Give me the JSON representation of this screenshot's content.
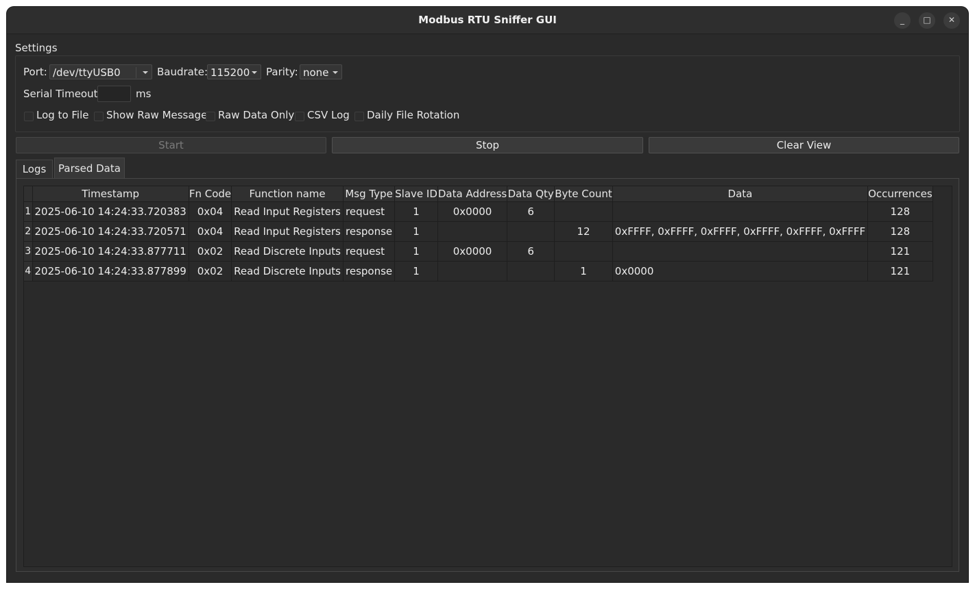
{
  "window": {
    "title": "Modbus RTU Sniffer GUI",
    "controls": {
      "minimize": "_",
      "maximize": "□",
      "close": "✕"
    }
  },
  "settings": {
    "group_label": "Settings",
    "port_label": "Port:",
    "port_value": "/dev/ttyUSB0",
    "baudrate_label": "Baudrate:",
    "baudrate_value": "115200",
    "parity_label": "Parity:",
    "parity_value": "none",
    "timeout_label": "Serial Timeout:",
    "timeout_value": "",
    "timeout_unit": "ms",
    "checkboxes": [
      {
        "label": "Log to File",
        "checked": false
      },
      {
        "label": "Show Raw Message",
        "checked": false
      },
      {
        "label": "Raw Data Only",
        "checked": false
      },
      {
        "label": "CSV Log",
        "checked": false
      },
      {
        "label": "Daily File Rotation",
        "checked": false
      }
    ]
  },
  "actions": {
    "start": "Start",
    "stop": "Stop",
    "clear": "Clear View"
  },
  "tabs": [
    {
      "label": "Logs"
    },
    {
      "label": "Parsed Data"
    }
  ],
  "table": {
    "columns": [
      "Timestamp",
      "Fn Code",
      "Function name",
      "Msg Type",
      "Slave ID",
      "Data Address",
      "Data Qty",
      "Byte Count",
      "Data",
      "Occurrences"
    ],
    "rows": [
      {
        "n": "1",
        "cells": [
          "2025-06-10 14:24:33.720383",
          "0x04",
          "Read Input Registers",
          "request",
          "1",
          "0x0000",
          "6",
          "",
          "",
          "128"
        ]
      },
      {
        "n": "2",
        "cells": [
          "2025-06-10 14:24:33.720571",
          "0x04",
          "Read Input Registers",
          "response",
          "1",
          "",
          "",
          "12",
          "0xFFFF, 0xFFFF, 0xFFFF, 0xFFFF, 0xFFFF, 0xFFFF",
          "128"
        ]
      },
      {
        "n": "3",
        "cells": [
          "2025-06-10 14:24:33.877711",
          "0x02",
          "Read Discrete Inputs",
          "request",
          "1",
          "0x0000",
          "6",
          "",
          "",
          "121"
        ]
      },
      {
        "n": "4",
        "cells": [
          "2025-06-10 14:24:33.877899",
          "0x02",
          "Read Discrete Inputs",
          "response",
          "1",
          "",
          "",
          "1",
          "0x0000",
          "121"
        ]
      }
    ]
  }
}
